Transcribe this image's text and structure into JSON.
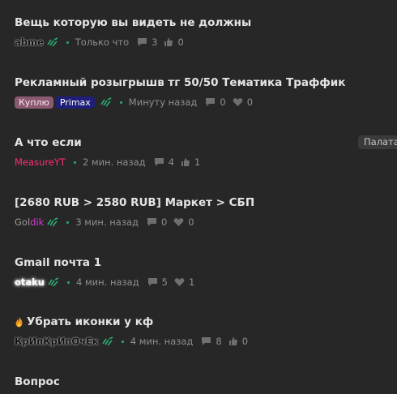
{
  "threads": [
    {
      "title": "Вещь которую вы видеть не должны",
      "author": "abme",
      "time": "Только что",
      "replies": "3",
      "likes": "0"
    },
    {
      "title": "Рекламный розыгрышв тг 50/50 Тематика Траффик",
      "badges": [
        "Куплю",
        "Primax"
      ],
      "time": "Минуту назад",
      "replies": "0",
      "likes": "0"
    },
    {
      "title": "А что если",
      "author": "MeasureYT",
      "time": "2 мин. назад",
      "replies": "4",
      "likes": "1"
    },
    {
      "title": "[2680 RUB > 2580 RUB] Маркет > СБП",
      "author_part1": "Gol",
      "author_part2": "dik",
      "time": "3 мин. назад",
      "replies": "0",
      "likes": "0"
    },
    {
      "title": "Gmail почта 1",
      "author": "otaku",
      "time": "4 мин. назад",
      "replies": "5",
      "likes": "1"
    },
    {
      "title": "Убрать иконки у кф",
      "author": "КрИпКрИпОчЕк",
      "time": "4 мин. назад",
      "replies": "8",
      "likes": "0"
    },
    {
      "title": "Вопрос"
    }
  ],
  "side_tag": "Палата",
  "colors": {
    "background": "#272727",
    "accent_green": "#2bad72",
    "text_title": "#e4e4e4",
    "text_meta": "#8f8f8f"
  },
  "icons": {
    "reply": "comment-icon",
    "like_thumb": "thumbs-up-icon",
    "like_heart": "heart-icon",
    "fire": "fire-icon",
    "author_mark": "green-eye-icon"
  }
}
